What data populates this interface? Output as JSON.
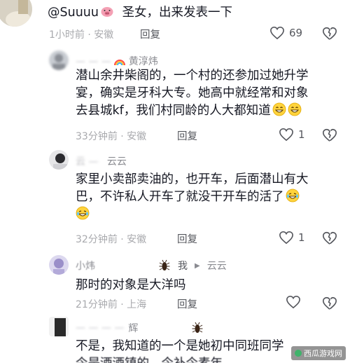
{
  "comments": [
    {
      "mention": "@Suuuu",
      "text": "圣女，出来发表一下",
      "time": "1小时前 · 安徽",
      "reply": "回复",
      "likes": "69"
    },
    {
      "name": "黄淳炜",
      "line1": "潜山余井柴阁的，一个村的还参加过她升学",
      "line2": "宴，确实是牙科大专。她高中就经常和对象",
      "line3": "去县城kf，我们村同龄的人大都知道",
      "time": "33分钟前 · 安徽",
      "reply": "回复",
      "likes": "1"
    },
    {
      "name": "云云",
      "line1": "家里小卖部卖油的，也开车，后面潜山有大",
      "line2": "巴，不许私人开车了就没干开车的活了",
      "time": "32分钟前 · 安徽",
      "reply": "回复",
      "likes": "1"
    },
    {
      "name": "小炜",
      "reply_arrow": "我",
      "reply_to": "云云",
      "line1": "那时的对象是大洋吗",
      "time": "21分钟前 · 上海",
      "reply": "回复"
    },
    {
      "name": "辉",
      "line1": "不是，我知道的一个是她初中同班同学",
      "line2": "今是酒酒镇的，今补今素年"
    }
  ],
  "watermark": "西瓜游戏网",
  "colors": {
    "text": "#161823",
    "meta": "#a8a9ad",
    "name": "#8a8b91"
  }
}
